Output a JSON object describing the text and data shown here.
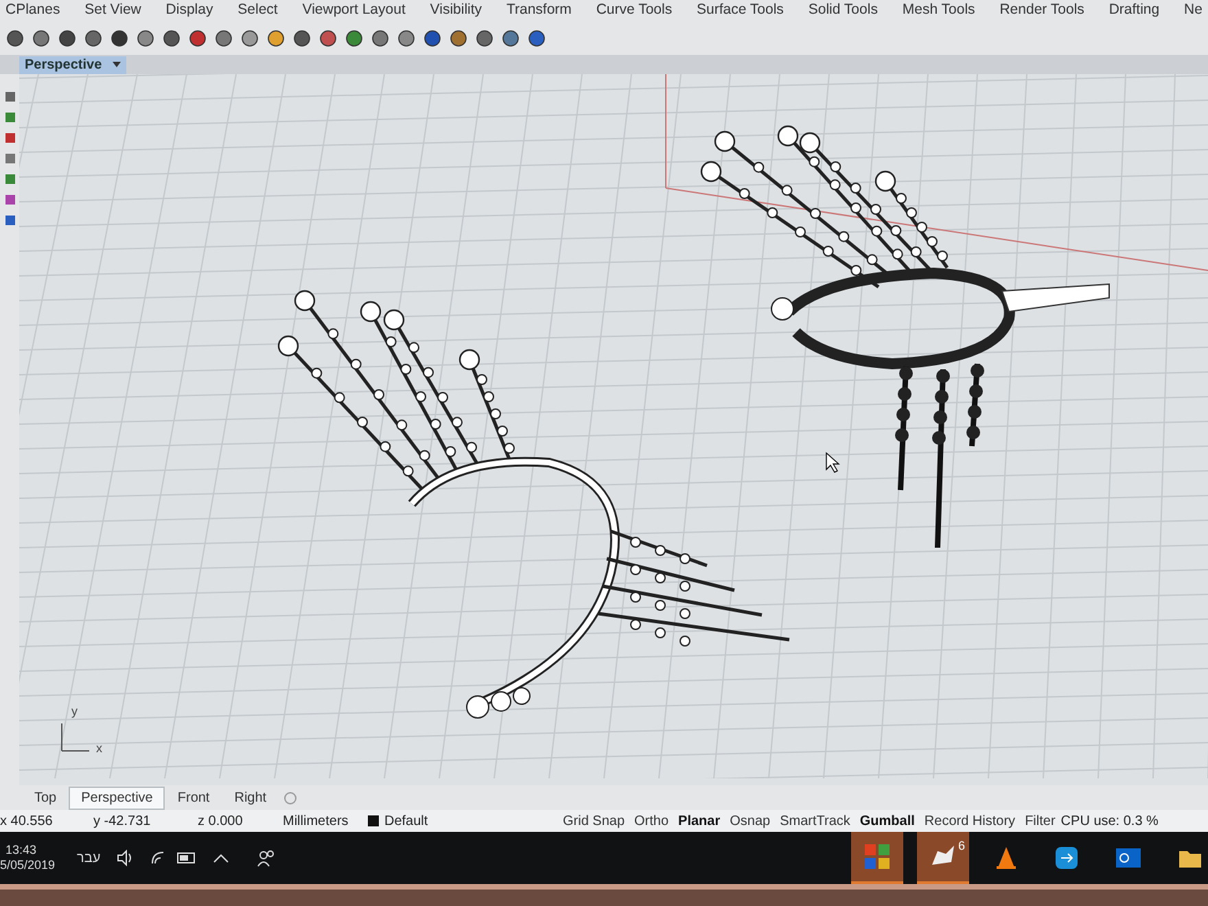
{
  "menu_tabs": [
    "CPlanes",
    "Set View",
    "Display",
    "Select",
    "Viewport Layout",
    "Visibility",
    "Transform",
    "Curve Tools",
    "Surface Tools",
    "Solid Tools",
    "Mesh Tools",
    "Render Tools",
    "Drafting",
    "Ne"
  ],
  "viewport": {
    "title": "Perspective",
    "axis_y": "y",
    "axis_x": "x"
  },
  "view_tabs": [
    {
      "label": "Top",
      "selected": false
    },
    {
      "label": "Perspective",
      "selected": true
    },
    {
      "label": "Front",
      "selected": false
    },
    {
      "label": "Right",
      "selected": false
    }
  ],
  "status_bar": {
    "x": "x 40.556",
    "y": "y -42.731",
    "z": "z 0.000",
    "units": "Millimeters",
    "layer": {
      "name": "Default",
      "color": "#111111"
    },
    "toggles": [
      {
        "label": "Grid Snap",
        "on": false
      },
      {
        "label": "Ortho",
        "on": false
      },
      {
        "label": "Planar",
        "on": true
      },
      {
        "label": "Osnap",
        "on": false
      },
      {
        "label": "SmartTrack",
        "on": false
      },
      {
        "label": "Gumball",
        "on": true
      },
      {
        "label": "Record History",
        "on": false
      },
      {
        "label": "Filter",
        "on": false
      }
    ],
    "cpu": "CPU use: 0.3 %"
  },
  "taskbar": {
    "time": "13:43",
    "date": "5/05/2019",
    "language": "עבר",
    "badge": "6"
  }
}
